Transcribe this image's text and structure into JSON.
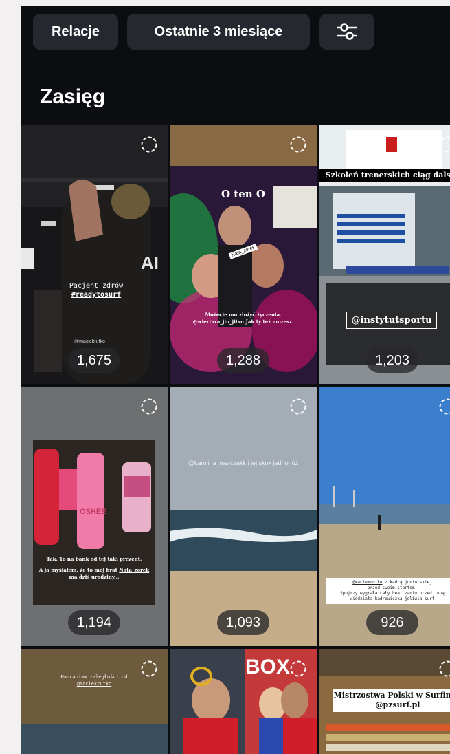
{
  "filters": {
    "relacje_label": "Relacje",
    "period_label": "Ostatnie 3 miesiące",
    "filter_icon": "sliders-icon"
  },
  "section": {
    "title": "Zasięg"
  },
  "stories": [
    {
      "count": "1,675",
      "caption": "Pacjent zdrów",
      "hashtag": "#readytosurf",
      "mention": "@maciekrutko"
    },
    {
      "count": "1,288",
      "caption": "O ten O",
      "sticker": "Nata_zorek",
      "note": "Możecie mu złożyć życzenia.",
      "note2": "@wiertara_jiu_jitsu Jak ty też możesz."
    },
    {
      "count": "1,203",
      "caption": "Szkoleń trenerskich ciąg dalszy",
      "mention": "@instytutsportu"
    },
    {
      "count": "1,194",
      "note": "Tak. To na bank od tej taki prezent.",
      "note2": "A ja myślałem, że to mój brat",
      "mention": "Nata_zorek",
      "note3": "ma dziś urodziny...",
      "brand": "OSHEE"
    },
    {
      "count": "1,093",
      "mention": "@karolina_marczakk",
      "caption": "i jej skok jednonóż"
    },
    {
      "count": "926",
      "mention": "@maciekrutko",
      "caption": "z kadrą juniorskiej",
      "note": "przed swoim startem.",
      "note2": "Spojrzy wygrała cały heat zanim przed inną",
      "note3": "wiedziała kadrowiczka",
      "mention2": "@oliwia_surf"
    },
    {
      "caption": "Nadrabiam zaległości od",
      "mention": "@maciekrutko"
    },
    {
      "caption": "BOX"
    },
    {
      "caption": "Mistrzostwa Polski w Surfingu",
      "mention": "@pzsurf.pl"
    }
  ]
}
